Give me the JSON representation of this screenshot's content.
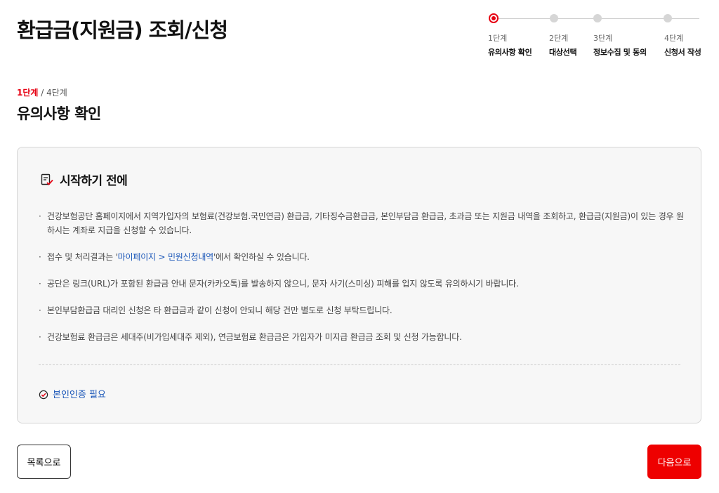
{
  "page": {
    "title": "환급금(지원금) 조회/신청"
  },
  "stepper": {
    "steps": [
      {
        "num": "1단계",
        "name": "유의사항 확인",
        "active": true
      },
      {
        "num": "2단계",
        "name": "대상선택",
        "active": false
      },
      {
        "num": "3단계",
        "name": "정보수집 및 동의",
        "active": false
      },
      {
        "num": "4단계",
        "name": "신청서 작성",
        "active": false
      }
    ]
  },
  "step_indicator": {
    "current": "1단계",
    "rest": " / 4단계"
  },
  "section": {
    "title": "유의사항 확인"
  },
  "notice": {
    "title": "시작하기 전에",
    "items": [
      {
        "text": "건강보험공단 홈페이지에서 지역가입자의 보험료(건강보험.국민연금) 환급금, 기타징수금환급금, 본인부담금 환급금, 초과금 또는 지원금 내역을 조회하고, 환급금(지원금)이 있는 경우 원하시는 계좌로 지급을 신청할 수 있습니다."
      },
      {
        "pre": "접수 및 처리결과는 '",
        "link": "마이페이지 > 민원신청내역",
        "post": "'에서 확인하실 수 있습니다."
      },
      {
        "text": "공단은 링크(URL)가 포함된 환급금 안내 문자(카카오톡)를 발송하지 않으니, 문자 사기(스미싱) 피해를 입지 않도록 유의하시기 바랍니다."
      },
      {
        "text": "본인부담환급금 대리인 신청은 타 환급금과 같이 신청이 안되니 해당 건만 별도로 신청 부탁드립니다."
      },
      {
        "text": "건강보험료 환급금은 세대주(비가입세대주 제외), 연금보험료 환급금은 가입자가 미지급 환급금 조회 및 신청 가능합니다."
      }
    ],
    "auth_label": "본인인증 필요"
  },
  "buttons": {
    "list": "목록으로",
    "next": "다음으로"
  },
  "colors": {
    "accent": "#e60012",
    "link": "#1a56b8",
    "box_bg": "#f7f7f7"
  },
  "icons": {
    "notice": "checklist-icon",
    "auth": "check-circle-icon"
  }
}
